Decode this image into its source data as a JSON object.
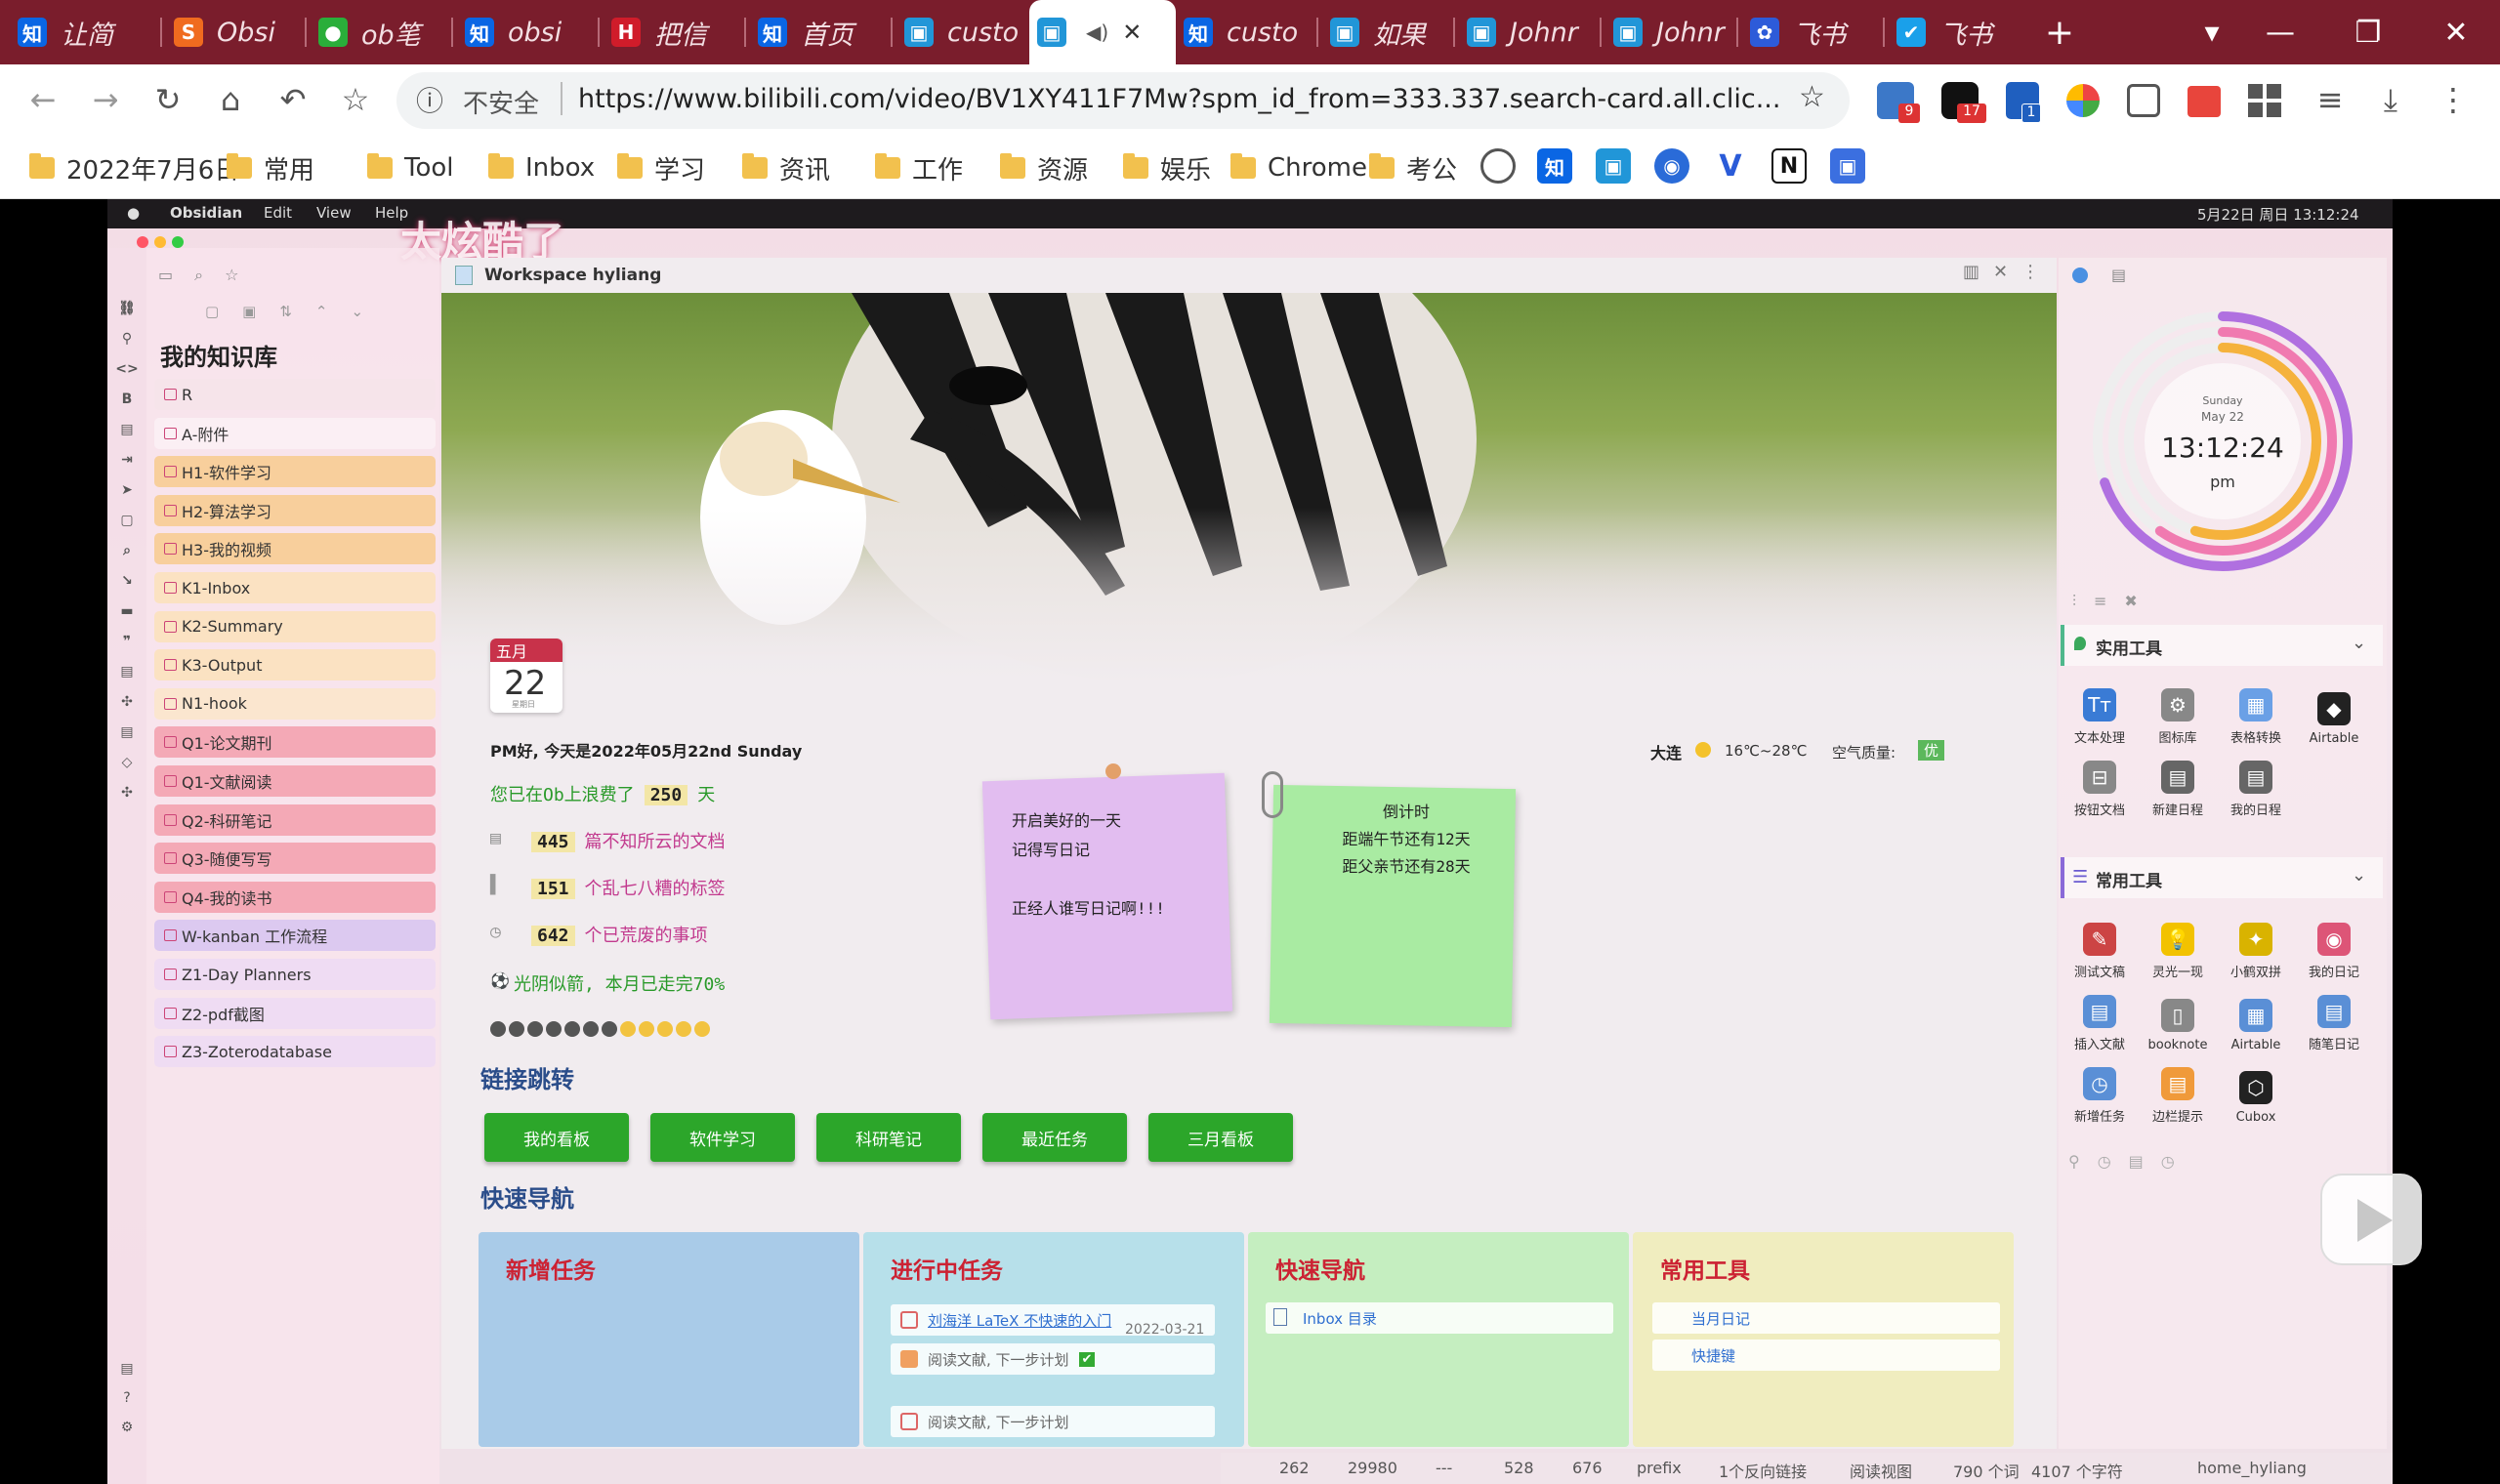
{
  "browser": {
    "tabs": [
      {
        "title": "让简",
        "icon": "知",
        "color": "#0a66e4"
      },
      {
        "title": "Obsi",
        "icon": "S",
        "color": "#f06b1f"
      },
      {
        "title": "ob笔",
        "icon": "●",
        "color": "#2aae3a"
      },
      {
        "title": "obsi",
        "icon": "知",
        "color": "#0a66e4"
      },
      {
        "title": "把信",
        "icon": "H",
        "color": "#d01c2a"
      },
      {
        "title": "首页",
        "icon": "知",
        "color": "#0a66e4"
      },
      {
        "title": "custo",
        "icon": "▣",
        "color": "#2196d8"
      },
      {
        "title": "",
        "icon": "▣",
        "color": "#2196d8"
      },
      {
        "title": "custo",
        "icon": "知",
        "color": "#0a66e4"
      },
      {
        "title": "如果",
        "icon": "▣",
        "color": "#2196d8"
      },
      {
        "title": "Johnr",
        "icon": "▣",
        "color": "#2196d8"
      },
      {
        "title": "Johnr",
        "icon": "▣",
        "color": "#2196d8"
      },
      {
        "title": "飞书",
        "icon": "✿",
        "color": "#2d5bd9"
      },
      {
        "title": "飞书",
        "icon": "✔",
        "color": "#1aa0ea"
      }
    ],
    "new_tab": "+",
    "dropdown": "▾",
    "window": {
      "minimize": "—",
      "restore": "❐",
      "close": "✕"
    },
    "nav": {
      "back": "←",
      "forward": "→",
      "reload": "↻",
      "home": "⌂",
      "undo": "↶",
      "star": "☆"
    },
    "omnibox": {
      "info_icon": "ⓘ",
      "insecure": "不安全",
      "url": "https://www.bilibili.com/video/BV1XY411F7Mw?spm_id_from=333.337.search-card.all.clic...",
      "bookmark": "☆"
    },
    "ext_badges": [
      "9",
      "17",
      "1"
    ],
    "menu_icon": "⋮",
    "bookmarks": [
      "2022年7月6日",
      "常用",
      "Tool",
      "Inbox",
      "学习",
      "资讯",
      "工作",
      "资源",
      "娱乐",
      "Chrome",
      "考公"
    ]
  },
  "mac": {
    "apple": "",
    "menus": [
      "Obsidian",
      "Edit",
      "View",
      "Help"
    ],
    "clock": "5月22日 周日 13:12:24"
  },
  "overlay_text": "太炫酷了",
  "vault": {
    "title": "我的知识库",
    "folders": [
      {
        "name": "R",
        "color": "#f6e4ea"
      },
      {
        "name": "A-附件",
        "color": "#fbeff4"
      },
      {
        "name": "H1-软件学习",
        "color": "#f8cf9c"
      },
      {
        "name": "H2-算法学习",
        "color": "#f8cf9c"
      },
      {
        "name": "H3-我的视频",
        "color": "#f8cf9c"
      },
      {
        "name": "K1-Inbox",
        "color": "#fbe2c2"
      },
      {
        "name": "K2-Summary",
        "color": "#fbe2c2"
      },
      {
        "name": "K3-Output",
        "color": "#fbe2c2"
      },
      {
        "name": "N1-hook",
        "color": "#fbe6cf"
      },
      {
        "name": "Q1-论文期刊",
        "color": "#f4a9b6"
      },
      {
        "name": "Q1-文献阅读",
        "color": "#f4a9b6"
      },
      {
        "name": "Q2-科研笔记",
        "color": "#f4a9b6"
      },
      {
        "name": "Q3-随便写写",
        "color": "#f4a9b6"
      },
      {
        "name": "Q4-我的读书",
        "color": "#f4a9b6"
      },
      {
        "name": "W-kanban 工作流程",
        "color": "#dcc9f0"
      },
      {
        "name": "Z1-Day Planners",
        "color": "#efdcf3"
      },
      {
        "name": "Z2-pdf截图",
        "color": "#efdcf3"
      },
      {
        "name": "Z3-Zoterodatabase",
        "color": "#efdcf3"
      }
    ]
  },
  "workspace": {
    "tab_title": "Workspace hyliang",
    "calendar": {
      "month": "五月",
      "day": "22",
      "weekday": "星期日"
    },
    "greeting": "PM好, 今天是2022年05月22nd Sunday",
    "weather": {
      "city": "大连",
      "temp": "16℃~28℃",
      "aq_label": "空气质量:",
      "aq": "优"
    },
    "stats": [
      {
        "pre": "您已在Ob上浪费了",
        "num": "250",
        "post": "天",
        "color": "#2a9a2a"
      },
      {
        "pre": "",
        "num": "445",
        "post": "篇不知所云的文档",
        "color": "#c23a8e"
      },
      {
        "pre": "",
        "num": "151",
        "post": "个乱七八糟的标签",
        "color": "#c23a8e"
      },
      {
        "pre": "",
        "num": "642",
        "post": "个已荒废的事项",
        "color": "#c23a8e"
      }
    ],
    "month_progress": "光阴似箭, 本月已走完70%",
    "progress_dots": {
      "total": 12,
      "filled": 9
    },
    "sticky_purple": [
      "开启美好的一天",
      "记得写日记",
      "",
      "正经人谁写日记啊!!!"
    ],
    "sticky_green": [
      "倒计时",
      "距端午节还有12天",
      "距父亲节还有28天"
    ],
    "links_heading": "链接跳转",
    "link_buttons": [
      "我的看板",
      "软件学习",
      "科研笔记",
      "最近任务",
      "三月看板"
    ],
    "nav_heading": "快速导航",
    "cards": [
      {
        "title": "新增任务",
        "bg": "#a9cbe8"
      },
      {
        "title": "进行中任务",
        "bg": "#b7e0ea"
      },
      {
        "title": "快速导航",
        "bg": "#c5eec0"
      },
      {
        "title": "常用工具",
        "bg": "#f0edbf"
      }
    ],
    "tasks": [
      {
        "text": "刘海洋 LaTeX 不快速的入门",
        "done": false
      },
      {
        "text": "阅读文献, 下一步计划",
        "done": true,
        "date": "2022-03-21"
      },
      {
        "text": "阅读文献, 下一步计划",
        "done": false
      }
    ],
    "quick_nav": [
      "Inbox 目录"
    ],
    "common_tools": [
      "当月日记",
      "快捷键"
    ]
  },
  "clock_widget": {
    "weekday": "Sunday",
    "date": "May 22",
    "time": "13:12:24",
    "ampm": "pm"
  },
  "tools": {
    "practical_title": "实用工具",
    "practical": [
      {
        "label": "文本处理",
        "glyph": "Tт",
        "color": "#3a7bd5"
      },
      {
        "label": "图标库",
        "glyph": "⚙",
        "color": "#888"
      },
      {
        "label": "表格转换",
        "glyph": "▦",
        "color": "#6aa0e6"
      },
      {
        "label": "Airtable",
        "glyph": "◆",
        "color": "#222"
      },
      {
        "label": "按钮文档",
        "glyph": "⊟",
        "color": "#888"
      },
      {
        "label": "新建日程",
        "glyph": "▤",
        "color": "#666"
      },
      {
        "label": "我的日程",
        "glyph": "▤",
        "color": "#666"
      }
    ],
    "common_title": "常用工具",
    "common": [
      {
        "label": "测试文稿",
        "glyph": "✎",
        "color": "#c44"
      },
      {
        "label": "灵光一现",
        "glyph": "💡",
        "color": "#f2c200"
      },
      {
        "label": "小鹤双拼",
        "glyph": "✦",
        "color": "#d9b300"
      },
      {
        "label": "我的日记",
        "glyph": "◉",
        "color": "#d57"
      },
      {
        "label": "插入文献",
        "glyph": "▤",
        "color": "#5a8fd6"
      },
      {
        "label": "booknote",
        "glyph": "▯",
        "color": "#888"
      },
      {
        "label": "Airtable",
        "glyph": "▦",
        "color": "#5a8fd6"
      },
      {
        "label": "随笔日记",
        "glyph": "▤",
        "color": "#5a8fd6"
      },
      {
        "label": "新增任务",
        "glyph": "◷",
        "color": "#5a8fd6"
      },
      {
        "label": "边栏提示",
        "glyph": "▤",
        "color": "#f09a3a"
      },
      {
        "label": "Cubox",
        "glyph": "⬡",
        "color": "#222"
      }
    ]
  },
  "status": {
    "backlinks": "262",
    "words_total": "29980",
    "modes": "---",
    "n528": "528",
    "n676": "676",
    "prefix": "prefix",
    "backlink_text": "1个反向链接",
    "read_view": "阅读视图",
    "words": "790 个词",
    "chars": "4107 个字符",
    "vault": "home_hyliang"
  }
}
